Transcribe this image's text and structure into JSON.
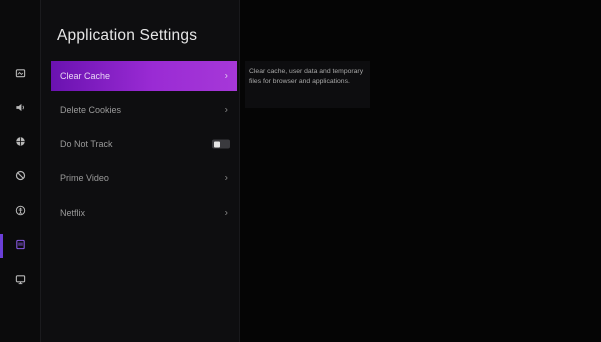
{
  "rail": {
    "items": [
      {
        "icon": "picture-icon"
      },
      {
        "icon": "sound-icon"
      },
      {
        "icon": "network-icon"
      },
      {
        "icon": "privacy-icon"
      },
      {
        "icon": "accessibility-icon"
      },
      {
        "icon": "applications-icon",
        "active": true
      },
      {
        "icon": "display-icon"
      }
    ]
  },
  "panel": {
    "title": "Application Settings",
    "items": [
      {
        "label": "Clear Cache",
        "type": "chevron",
        "selected": true,
        "chevron": "›"
      },
      {
        "label": "Delete Cookies",
        "type": "chevron",
        "chevron": "›"
      },
      {
        "label": "Do Not Track",
        "type": "toggle",
        "toggle_on": false
      },
      {
        "label": "Prime Video",
        "type": "chevron",
        "chevron": "›"
      },
      {
        "label": "Netflix",
        "type": "chevron",
        "chevron": "›"
      }
    ]
  },
  "description": {
    "text": "Clear cache, user data and temporary files for browser and applications."
  },
  "colors": {
    "accent": "#8a22c8",
    "background": "#050505",
    "rail_active": "#6b3fd8"
  }
}
